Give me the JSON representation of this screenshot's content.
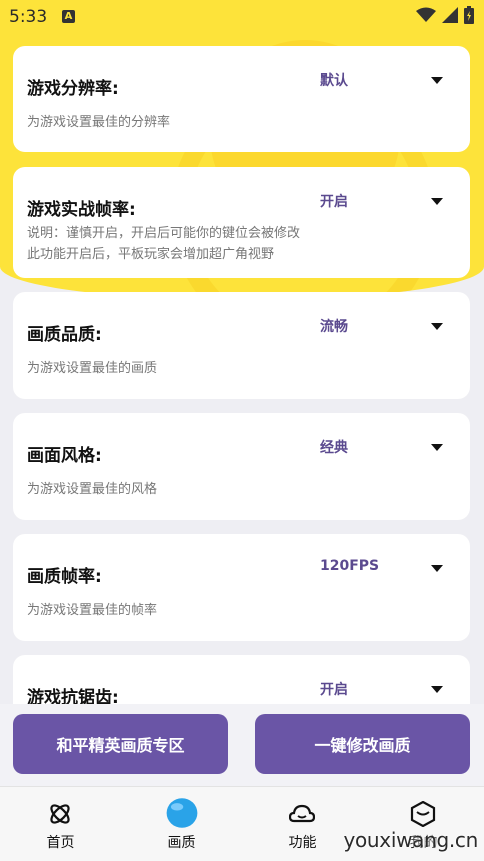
{
  "status_bar": {
    "time": "5:33",
    "notification_badge": "A"
  },
  "cards": [
    {
      "title": "游戏分辨率:",
      "value": "默认",
      "desc_lines": [
        "为游戏设置最佳的分辨率"
      ]
    },
    {
      "title": "游戏实战帧率:",
      "value": "开启",
      "desc_lines": [
        "说明：谨慎开启，开启后可能你的键位会被修改",
        "此功能开启后，平板玩家会增加超广角视野"
      ]
    },
    {
      "title": "画质品质:",
      "value": "流畅",
      "desc_lines": [
        "为游戏设置最佳的画质"
      ]
    },
    {
      "title": "画面风格:",
      "value": "经典",
      "desc_lines": [
        "为游戏设置最佳的风格"
      ]
    },
    {
      "title": "画质帧率:",
      "value": "120FPS",
      "desc_lines": [
        "为游戏设置最佳的帧率"
      ]
    },
    {
      "title": "游戏抗锯齿:",
      "value": "开启",
      "desc_lines": []
    }
  ],
  "actions": {
    "left": "和平精英画质专区",
    "right": "一键修改画质"
  },
  "nav": [
    {
      "label": "首页",
      "icon": "atom-icon"
    },
    {
      "label": "画质",
      "icon": "blue-ball-icon"
    },
    {
      "label": "功能",
      "icon": "cloud-icon"
    },
    {
      "label": "我的",
      "icon": "hexagon-icon"
    }
  ],
  "watermark": "youxiwang.cn",
  "colors": {
    "header_yellow": "#fde33a",
    "accent_purple": "#6a55a6",
    "value_purple": "#5b4a8f"
  }
}
